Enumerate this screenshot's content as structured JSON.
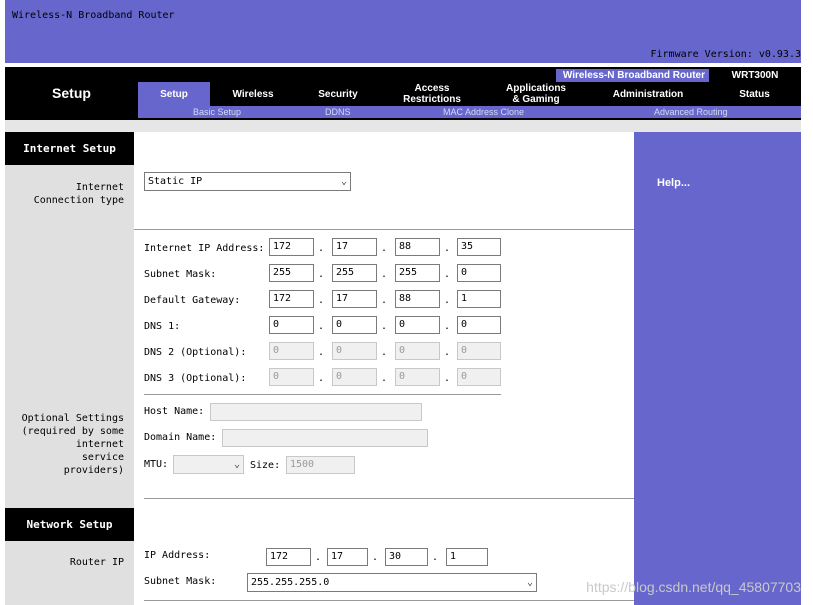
{
  "banner": {
    "product": "Wireless-N Broadband Router",
    "firmware": "Firmware Version: v0.93.3"
  },
  "header": {
    "section": "Setup",
    "model_name": "Wireless-N Broadband Router",
    "model_number": "WRT300N",
    "tabs": [
      {
        "label": "Setup"
      },
      {
        "label": "Wireless"
      },
      {
        "label": "Security"
      },
      {
        "label": "Access\nRestrictions"
      },
      {
        "label": "Applications\n& Gaming"
      },
      {
        "label": "Administration"
      },
      {
        "label": "Status"
      }
    ],
    "subtabs": [
      "Basic Setup",
      "DDNS",
      "MAC Address Clone",
      "Advanced Routing"
    ]
  },
  "internet_setup": {
    "heading": "Internet Setup",
    "conn_type_label": "Internet\nConnection type",
    "conn_type_value": "Static IP",
    "ip_label": "Internet IP Address:",
    "ip": [
      "172",
      "17",
      "88",
      "35"
    ],
    "mask_label": "Subnet Mask:",
    "mask": [
      "255",
      "255",
      "255",
      "0"
    ],
    "gateway_label": "Default Gateway:",
    "gateway": [
      "172",
      "17",
      "88",
      "1"
    ],
    "dns1_label": "DNS 1:",
    "dns1": [
      "0",
      "0",
      "0",
      "0"
    ],
    "dns2_label": "DNS 2 (Optional):",
    "dns2": [
      "0",
      "0",
      "0",
      "0"
    ],
    "dns3_label": "DNS 3 (Optional):",
    "dns3": [
      "0",
      "0",
      "0",
      "0"
    ],
    "optional_label": "Optional Settings\n(required by some\ninternet\nservice\nproviders)",
    "host_label": "Host Name:",
    "host_value": "",
    "domain_label": "Domain Name:",
    "domain_value": "",
    "mtu_label": "MTU:",
    "mtu_value": "",
    "size_label": "Size:",
    "size_value": "1500"
  },
  "network_setup": {
    "heading": "Network Setup",
    "router_ip_label": "Router IP",
    "ip_label": "IP Address:",
    "ip": [
      "172",
      "17",
      "30",
      "1"
    ],
    "mask_label": "Subnet Mask:",
    "mask_value": "255.255.255.0"
  },
  "help": {
    "title": "Help..."
  },
  "watermark": "https://blog.csdn.net/qq_45807703"
}
